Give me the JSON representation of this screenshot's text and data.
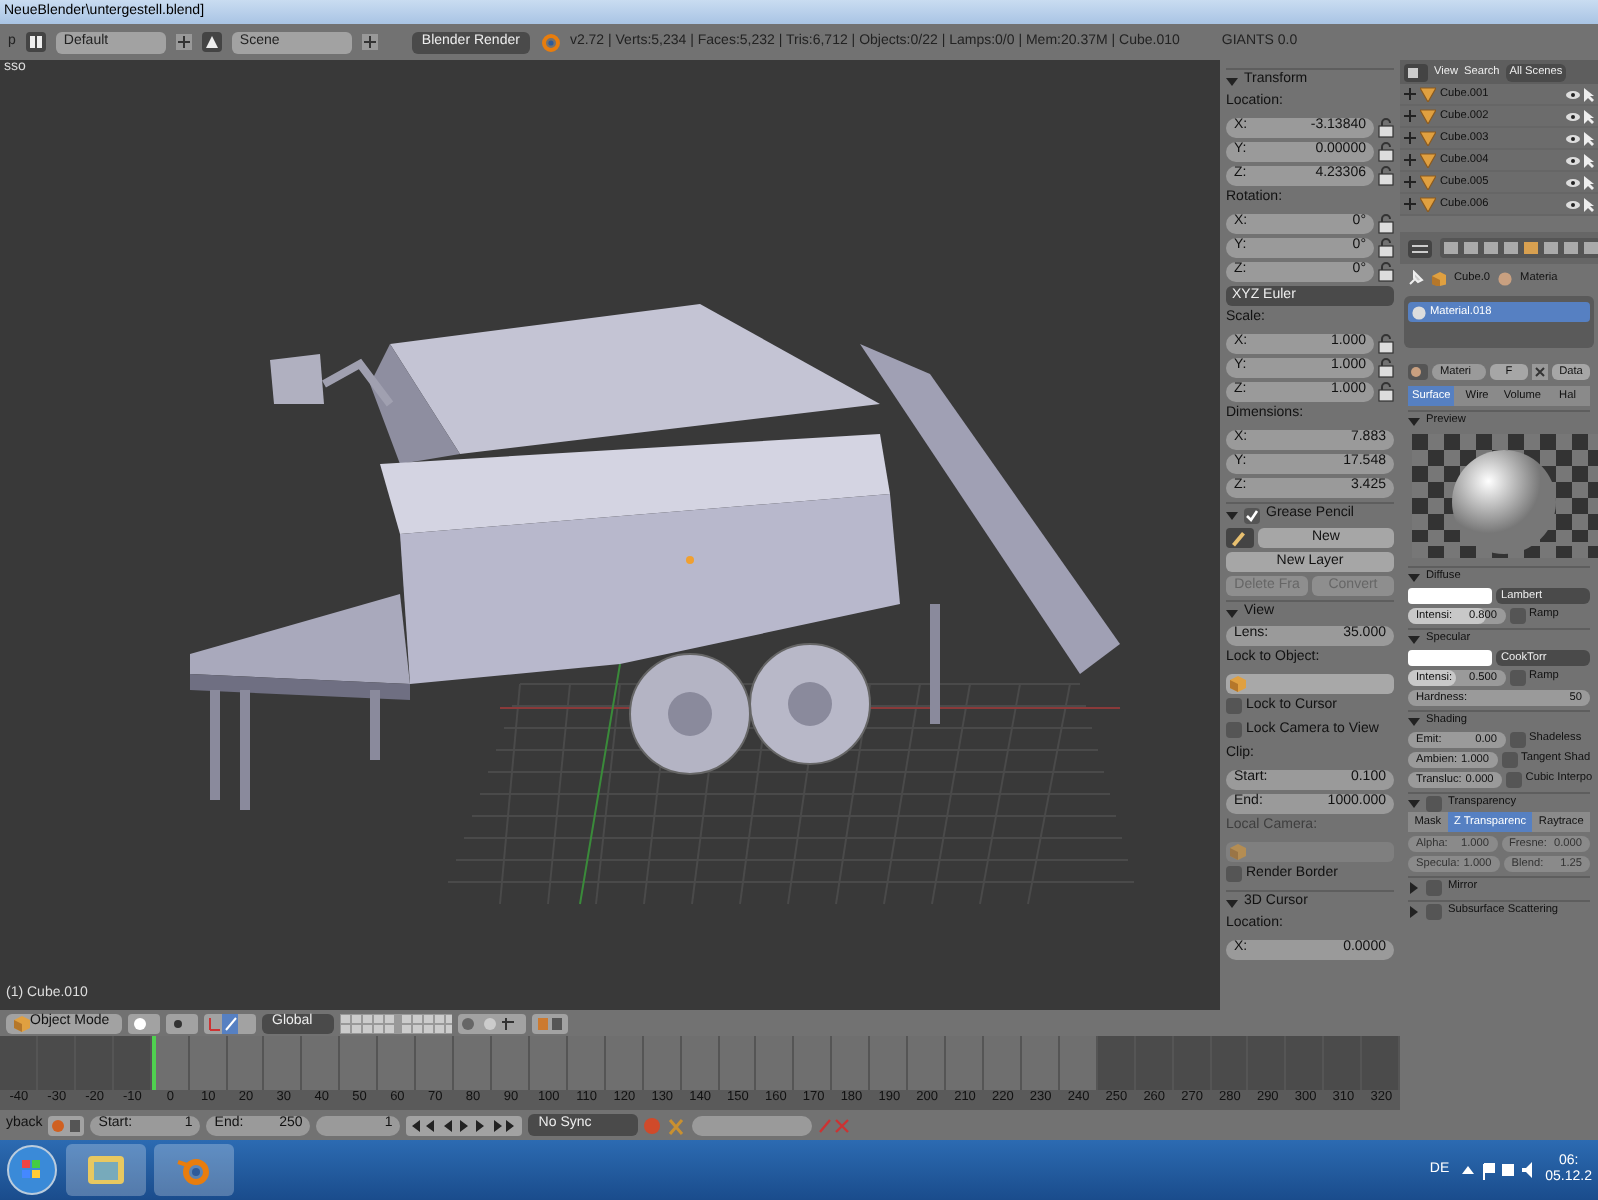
{
  "window": {
    "title": "NeueBlender\\untergestell.blend]"
  },
  "info_header": {
    "menu_cut": "p",
    "screen": "Default",
    "scene": "Scene",
    "engine": "Blender Render",
    "stats": "v2.72 | Verts:5,234 | Faces:5,232 | Tris:6,712 | Objects:0/22 | Lamps:0/0 | Mem:20.37M | Cube.010",
    "extra": "GIANTS 0.0"
  },
  "viewport": {
    "view_label": "sso",
    "object_label": "(1) Cube.010"
  },
  "n_panel": {
    "sections": [
      {
        "title": "Transform",
        "expanded": true,
        "rows": [
          {
            "cells": [
              {
                "kind": "label",
                "text": "Location:"
              }
            ]
          },
          {
            "cells": [
              {
                "kind": "num",
                "label": "X:",
                "value": "-3.13840"
              },
              {
                "kind": "lock"
              }
            ]
          },
          {
            "cells": [
              {
                "kind": "num",
                "label": "Y:",
                "value": "0.00000"
              },
              {
                "kind": "lock"
              }
            ]
          },
          {
            "cells": [
              {
                "kind": "num",
                "label": "Z:",
                "value": "4.23306"
              },
              {
                "kind": "lock"
              }
            ]
          },
          {
            "cells": [
              {
                "kind": "label",
                "text": "Rotation:"
              }
            ]
          },
          {
            "cells": [
              {
                "kind": "num",
                "label": "X:",
                "value": "0°"
              },
              {
                "kind": "lock"
              }
            ]
          },
          {
            "cells": [
              {
                "kind": "num",
                "label": "Y:",
                "value": "0°"
              },
              {
                "kind": "lock"
              }
            ]
          },
          {
            "cells": [
              {
                "kind": "num",
                "label": "Z:",
                "value": "0°"
              },
              {
                "kind": "lock"
              }
            ]
          },
          {
            "cells": [
              {
                "kind": "enum",
                "value": "XYZ Euler"
              }
            ]
          },
          {
            "cells": [
              {
                "kind": "label",
                "text": "Scale:"
              }
            ]
          },
          {
            "cells": [
              {
                "kind": "num",
                "label": "X:",
                "value": "1.000"
              },
              {
                "kind": "lock"
              }
            ]
          },
          {
            "cells": [
              {
                "kind": "num",
                "label": "Y:",
                "value": "1.000"
              },
              {
                "kind": "lock"
              }
            ]
          },
          {
            "cells": [
              {
                "kind": "num",
                "label": "Z:",
                "value": "1.000"
              },
              {
                "kind": "lock"
              }
            ]
          },
          {
            "cells": [
              {
                "kind": "label",
                "text": "Dimensions:"
              }
            ]
          },
          {
            "cells": [
              {
                "kind": "num",
                "label": "X:",
                "value": "7.883"
              }
            ]
          },
          {
            "cells": [
              {
                "kind": "num",
                "label": "Y:",
                "value": "17.548"
              }
            ]
          },
          {
            "cells": [
              {
                "kind": "num",
                "label": "Z:",
                "value": "3.425"
              }
            ]
          }
        ]
      },
      {
        "title": "Grease Pencil",
        "expanded": true,
        "checked": true,
        "rows": [
          {
            "cells": [
              {
                "kind": "pencil"
              },
              {
                "kind": "button",
                "text": "New",
                "disabled": false
              }
            ]
          },
          {
            "cells": [
              {
                "kind": "button",
                "text": "New Layer",
                "disabled": false
              }
            ]
          },
          {
            "cells": [
              {
                "kind": "button",
                "text": "Delete Fra",
                "disabled": true
              },
              {
                "kind": "button",
                "text": "Convert",
                "disabled": true
              }
            ]
          }
        ]
      },
      {
        "title": "View",
        "expanded": true,
        "rows": [
          {
            "cells": [
              {
                "kind": "num",
                "label": "Lens:",
                "value": "35.000"
              }
            ]
          },
          {
            "cells": [
              {
                "kind": "label",
                "text": "Lock to Object:",
                "disabled": false
              }
            ]
          },
          {
            "cells": [
              {
                "kind": "object_field",
                "disabled": false
              }
            ]
          },
          {
            "cells": [
              {
                "kind": "check",
                "label": "Lock to Cursor",
                "checked": false
              }
            ]
          },
          {
            "cells": [
              {
                "kind": "check",
                "label": "Lock Camera to View",
                "checked": false
              }
            ]
          },
          {
            "cells": [
              {
                "kind": "label",
                "text": "Clip:",
                "disabled": false
              }
            ]
          },
          {
            "cells": [
              {
                "kind": "num",
                "label": "Start:",
                "value": "0.100"
              }
            ]
          },
          {
            "cells": [
              {
                "kind": "num",
                "label": "End:",
                "value": "1000.000"
              }
            ]
          },
          {
            "cells": [
              {
                "kind": "label",
                "text": "Local Camera:",
                "disabled": true
              }
            ]
          },
          {
            "cells": [
              {
                "kind": "object_field",
                "disabled": true
              }
            ]
          },
          {
            "cells": [
              {
                "kind": "check",
                "label": "Render Border",
                "checked": false
              }
            ]
          }
        ]
      },
      {
        "title": "3D Cursor",
        "expanded": true,
        "rows": [
          {
            "cells": [
              {
                "kind": "label",
                "text": "Location:",
                "disabled": false
              }
            ]
          },
          {
            "cells": [
              {
                "kind": "num",
                "label": "X:",
                "value": "0.0000"
              }
            ]
          }
        ]
      }
    ]
  },
  "outliner": {
    "menus": [
      "View",
      "Search"
    ],
    "filter": "All Scenes",
    "items": [
      {
        "name": "Cube.001"
      },
      {
        "name": "Cube.002"
      },
      {
        "name": "Cube.003"
      },
      {
        "name": "Cube.004"
      },
      {
        "name": "Cube.005"
      },
      {
        "name": "Cube.006"
      }
    ]
  },
  "properties": {
    "breadcrumb": [
      "Cube.0",
      "Materia"
    ],
    "slots": [
      {
        "name": "Material.018",
        "selected": true
      }
    ],
    "datablock": {
      "name": "Materi",
      "fake_user": "F",
      "extra": "Data"
    },
    "tabs": [
      {
        "label": "Surface",
        "selected": true
      },
      {
        "label": "Wire",
        "selected": false
      },
      {
        "label": "Volume",
        "selected": false
      },
      {
        "label": "Hal",
        "selected": false
      }
    ],
    "sections": [
      {
        "title": "Preview",
        "expanded": true,
        "preview": true
      },
      {
        "title": "Diffuse",
        "expanded": true,
        "rows": [
          {
            "cells": [
              {
                "kind": "swatch"
              },
              {
                "kind": "enum",
                "value": "Lambert"
              }
            ]
          },
          {
            "cells": [
              {
                "kind": "slider",
                "label": "Intensi:",
                "value": "0.800",
                "level": 0.8
              },
              {
                "kind": "check",
                "label": "Ramp",
                "checked": false
              }
            ]
          }
        ]
      },
      {
        "title": "Specular",
        "expanded": true,
        "rows": [
          {
            "cells": [
              {
                "kind": "swatch"
              },
              {
                "kind": "enum",
                "value": "CookTorr"
              }
            ]
          },
          {
            "cells": [
              {
                "kind": "slider",
                "label": "Intensi:",
                "value": "0.500",
                "level": 0.5
              },
              {
                "kind": "check",
                "label": "Ramp",
                "checked": false
              }
            ]
          },
          {
            "cells": [
              {
                "kind": "num",
                "label": "Hardness:",
                "value": "50"
              }
            ]
          }
        ]
      },
      {
        "title": "Shading",
        "expanded": true,
        "rows": [
          {
            "cells": [
              {
                "kind": "num",
                "label": "Emit:",
                "value": "0.00"
              },
              {
                "kind": "check",
                "label": "Shadeless",
                "checked": false
              }
            ]
          },
          {
            "cells": [
              {
                "kind": "num",
                "label": "Ambien:",
                "value": "1.000"
              },
              {
                "kind": "check",
                "label": "Tangent Shad",
                "checked": false
              }
            ]
          },
          {
            "cells": [
              {
                "kind": "num",
                "label": "Transluc:",
                "value": "0.000"
              },
              {
                "kind": "check",
                "label": "Cubic Interpo",
                "checked": false
              }
            ]
          }
        ]
      },
      {
        "title": "Transparency",
        "expanded": true,
        "checked": false,
        "rows": [
          {
            "cells": [
              {
                "kind": "segment",
                "items": [
                  {
                    "text": "Mask",
                    "selected": false
                  },
                  {
                    "text": "Z Transparenc",
                    "selected": true
                  },
                  {
                    "text": "Raytrace",
                    "selected": false
                  }
                ]
              }
            ]
          },
          {
            "cells": [
              {
                "kind": "num",
                "label": "Alpha:",
                "value": "1.000",
                "disabled": true
              },
              {
                "kind": "num",
                "label": "Fresne:",
                "value": "0.000",
                "disabled": true
              }
            ]
          },
          {
            "cells": [
              {
                "kind": "num",
                "label": "Specula:",
                "value": "1.000",
                "disabled": true
              },
              {
                "kind": "num",
                "label": "Blend:",
                "value": "1.25",
                "disabled": true
              }
            ]
          }
        ]
      },
      {
        "title": "Mirror",
        "expanded": false,
        "checked": false
      },
      {
        "title": "Subsurface Scattering",
        "expanded": false,
        "checked": false
      }
    ]
  },
  "view_header": {
    "mode": "Object Mode",
    "orientation": "Global"
  },
  "timeline": {
    "ticks": [
      {
        "label": "-40",
        "in_range": false,
        "current": false
      },
      {
        "label": "-30",
        "in_range": false,
        "current": false
      },
      {
        "label": "-20",
        "in_range": false,
        "current": false
      },
      {
        "label": "-10",
        "in_range": false,
        "current": false
      },
      {
        "label": "0",
        "in_range": true,
        "current": true
      },
      {
        "label": "10",
        "in_range": true,
        "current": false
      },
      {
        "label": "20",
        "in_range": true,
        "current": false
      },
      {
        "label": "30",
        "in_range": true,
        "current": false
      },
      {
        "label": "40",
        "in_range": true,
        "current": false
      },
      {
        "label": "50",
        "in_range": true,
        "current": false
      },
      {
        "label": "60",
        "in_range": true,
        "current": false
      },
      {
        "label": "70",
        "in_range": true,
        "current": false
      },
      {
        "label": "80",
        "in_range": true,
        "current": false
      },
      {
        "label": "90",
        "in_range": true,
        "current": false
      },
      {
        "label": "100",
        "in_range": true,
        "current": false
      },
      {
        "label": "110",
        "in_range": true,
        "current": false
      },
      {
        "label": "120",
        "in_range": true,
        "current": false
      },
      {
        "label": "130",
        "in_range": true,
        "current": false
      },
      {
        "label": "140",
        "in_range": true,
        "current": false
      },
      {
        "label": "150",
        "in_range": true,
        "current": false
      },
      {
        "label": "160",
        "in_range": true,
        "current": false
      },
      {
        "label": "170",
        "in_range": true,
        "current": false
      },
      {
        "label": "180",
        "in_range": true,
        "current": false
      },
      {
        "label": "190",
        "in_range": true,
        "current": false
      },
      {
        "label": "200",
        "in_range": true,
        "current": false
      },
      {
        "label": "210",
        "in_range": true,
        "current": false
      },
      {
        "label": "220",
        "in_range": true,
        "current": false
      },
      {
        "label": "230",
        "in_range": true,
        "current": false
      },
      {
        "label": "240",
        "in_range": true,
        "current": false
      },
      {
        "label": "250",
        "in_range": false,
        "current": false
      },
      {
        "label": "260",
        "in_range": false,
        "current": false
      },
      {
        "label": "270",
        "in_range": false,
        "current": false
      },
      {
        "label": "280",
        "in_range": false,
        "current": false
      },
      {
        "label": "290",
        "in_range": false,
        "current": false
      },
      {
        "label": "300",
        "in_range": false,
        "current": false
      },
      {
        "label": "310",
        "in_range": false,
        "current": false
      },
      {
        "label": "320",
        "in_range": false,
        "current": false
      }
    ]
  },
  "timeline_header": {
    "menu_cut": "yback",
    "start_label": "Start:",
    "start": "1",
    "end_label": "End:",
    "end": "250",
    "frame": "1",
    "sync": "No Sync"
  },
  "taskbar": {
    "language": "DE",
    "time": "06:",
    "date": "05.12.2"
  }
}
